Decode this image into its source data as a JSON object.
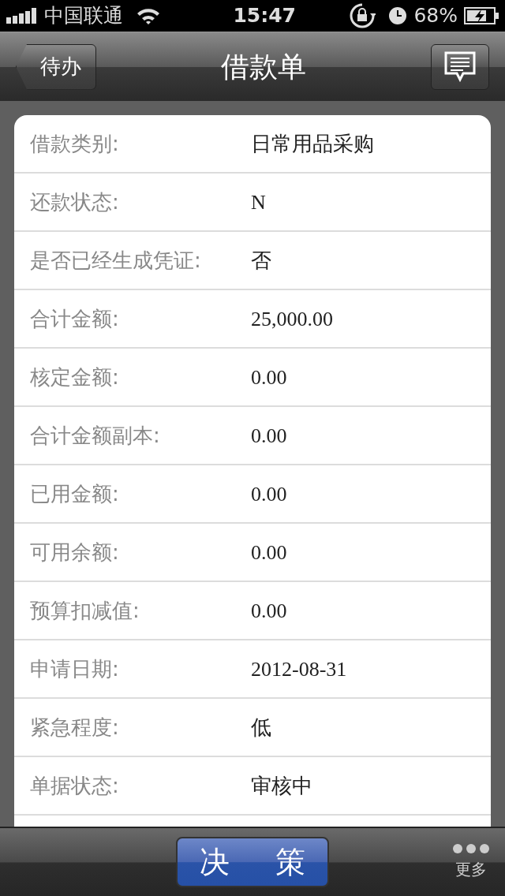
{
  "status_bar": {
    "carrier": "中国联通",
    "time": "15:47",
    "battery": "68%"
  },
  "nav": {
    "back": "待办",
    "title": "借款单"
  },
  "fields": [
    {
      "label": "借款类别:",
      "value": "日常用品采购"
    },
    {
      "label": "还款状态:",
      "value": "N"
    },
    {
      "label": "是否已经生成凭证:",
      "value": "否"
    },
    {
      "label": "合计金额:",
      "value": "25,000.00"
    },
    {
      "label": "核定金额:",
      "value": "0.00"
    },
    {
      "label": "合计金额副本:",
      "value": "0.00"
    },
    {
      "label": "已用金额:",
      "value": "0.00"
    },
    {
      "label": "可用余额:",
      "value": "0.00"
    },
    {
      "label": "预算扣减值:",
      "value": "0.00"
    },
    {
      "label": "申请日期:",
      "value": "2012-08-31"
    },
    {
      "label": "紧急程度:",
      "value": "低"
    },
    {
      "label": "单据状态:",
      "value": "审核中"
    }
  ],
  "toolbar": {
    "action": "决 策",
    "more": "更多"
  }
}
